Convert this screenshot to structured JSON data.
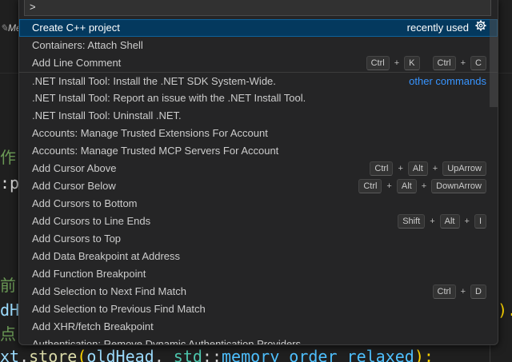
{
  "palette": {
    "input_value": ">",
    "items": [
      {
        "label": "Create C++ project",
        "selected": true,
        "right_text": "recently used",
        "has_gear": true
      },
      {
        "label": "Containers: Attach Shell"
      },
      {
        "label": "Add Line Comment",
        "chords": [
          [
            "Ctrl",
            "K"
          ],
          [
            "Ctrl",
            "C"
          ]
        ]
      },
      {
        "label": ".NET Install Tool: Install the .NET SDK System-Wide.",
        "divider": true,
        "link": "other commands"
      },
      {
        "label": ".NET Install Tool: Report an issue with the .NET Install Tool."
      },
      {
        "label": ".NET Install Tool: Uninstall .NET."
      },
      {
        "label": "Accounts: Manage Trusted Extensions For Account"
      },
      {
        "label": "Accounts: Manage Trusted MCP Servers For Account"
      },
      {
        "label": "Add Cursor Above",
        "chords": [
          [
            "Ctrl",
            "Alt",
            "UpArrow"
          ]
        ]
      },
      {
        "label": "Add Cursor Below",
        "chords": [
          [
            "Ctrl",
            "Alt",
            "DownArrow"
          ]
        ]
      },
      {
        "label": "Add Cursors to Bottom"
      },
      {
        "label": "Add Cursors to Line Ends",
        "chords": [
          [
            "Shift",
            "Alt",
            "I"
          ]
        ]
      },
      {
        "label": "Add Cursors to Top"
      },
      {
        "label": "Add Data Breakpoint at Address"
      },
      {
        "label": "Add Function Breakpoint"
      },
      {
        "label": "Add Selection to Next Find Match",
        "chords": [
          [
            "Ctrl",
            "D"
          ]
        ]
      },
      {
        "label": "Add Selection to Previous Find Match"
      },
      {
        "label": "Add XHR/fetch Breakpoint"
      },
      {
        "label": "Authentication: Remove Dynamic Authentication Providers"
      }
    ]
  },
  "editor": {
    "tab_fragment": "Me",
    "fragments": [
      "作",
      ":p",
      "前",
      "dH",
      "点",
      ")."
    ],
    "code_line": [
      "xt",
      ".",
      "store",
      "(",
      "oldHead",
      ", ",
      "std",
      "::",
      "memory_order_relaxed",
      ");"
    ]
  },
  "colors": {
    "selection_bg": "#04395e",
    "link": "#3794ff",
    "palette_bg": "#252526"
  }
}
